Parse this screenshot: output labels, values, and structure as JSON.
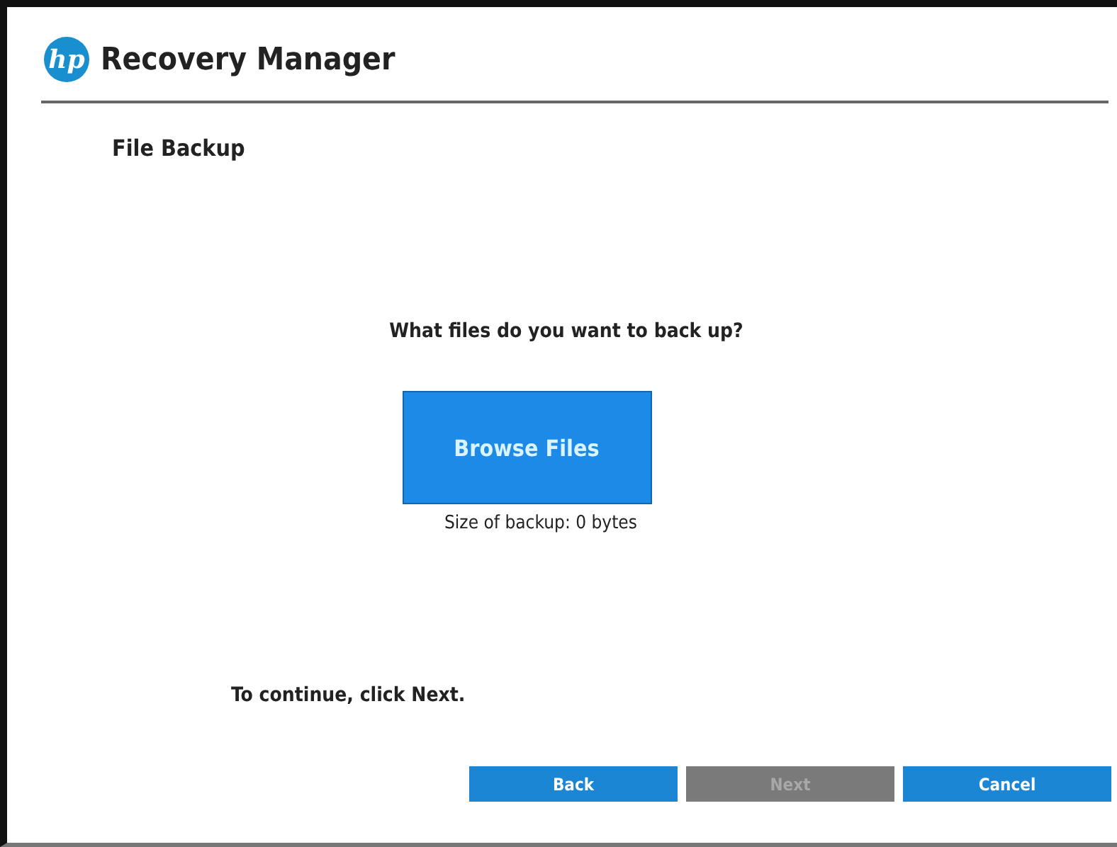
{
  "window": {
    "logo": "hp",
    "title": "Recovery Manager"
  },
  "page": {
    "heading": "File Backup",
    "question": "What files do you want to back up?",
    "browse_button": "Browse Files",
    "backup_size": "Size of backup:  0 bytes",
    "instruction": "To continue, click Next."
  },
  "buttons": [
    {
      "label": "Back",
      "disabled": false
    },
    {
      "label": "Next",
      "disabled": true
    },
    {
      "label": "Cancel",
      "disabled": false
    }
  ]
}
